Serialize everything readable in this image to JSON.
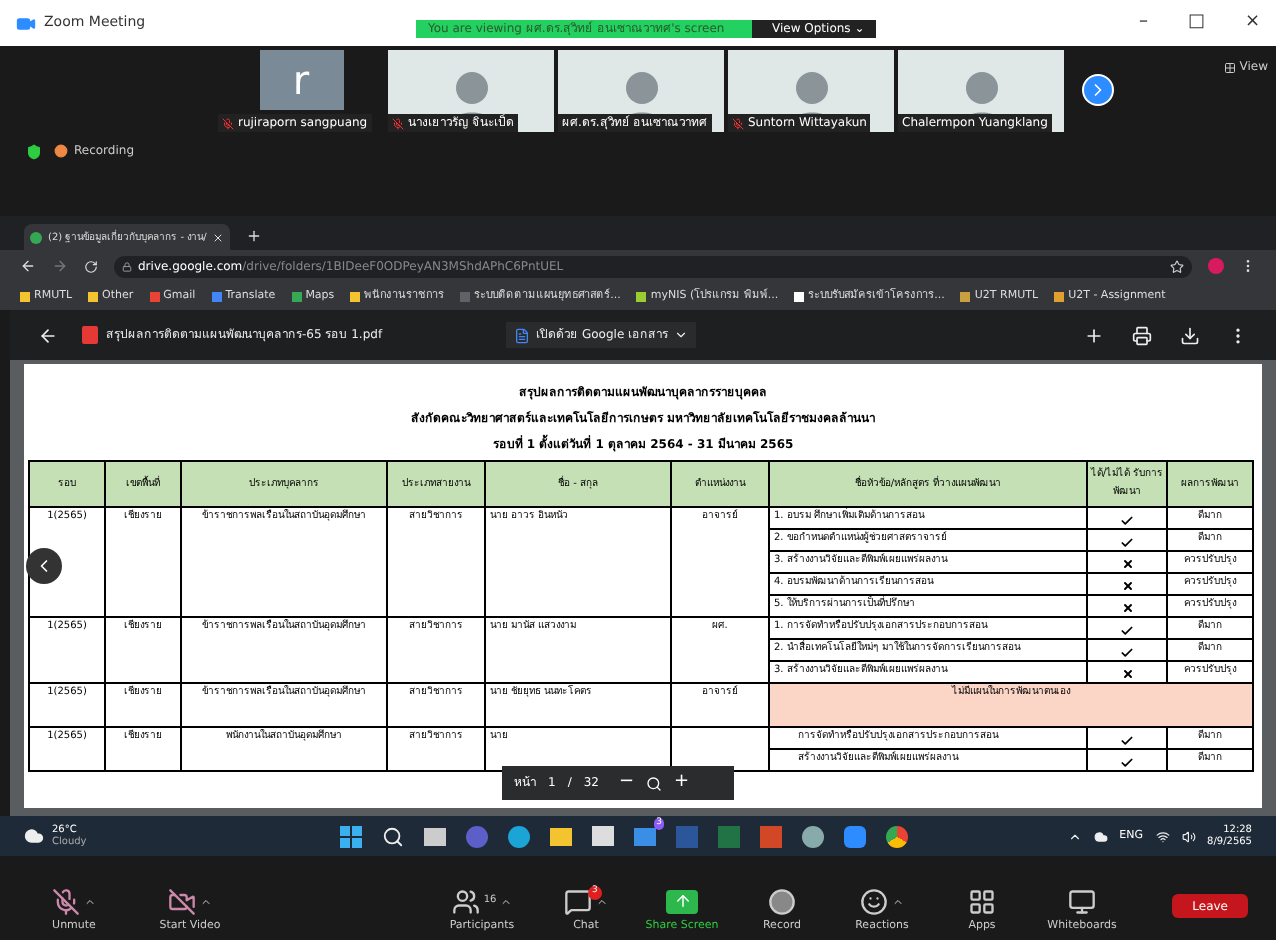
{
  "window": {
    "title": "Zoom Meeting",
    "controls": [
      "–",
      "□",
      "×"
    ]
  },
  "share_banner": {
    "text": "You are viewing ผศ.ดร.สุวิทย์ อนเซาณวาทศ's screen",
    "options": "View Options ⌄"
  },
  "participants": [
    {
      "name": "rujiraporn sangpuang",
      "kind": "avatar",
      "initial": "r",
      "muted": true
    },
    {
      "name": "นางเยาวรัญ จินะเป็ด",
      "kind": "video",
      "muted": true
    },
    {
      "name": "ผศ.ดร.สุวิทย์ อนเซาณวาทศ",
      "kind": "video",
      "muted": false
    },
    {
      "name": "Suntorn Wittayakun",
      "kind": "video",
      "muted": true
    },
    {
      "name": "Chalermpon Yuangklang",
      "kind": "video",
      "muted": false
    }
  ],
  "view_button": "View",
  "recording": "Recording",
  "browser": {
    "tab": "(2) ฐานข้อมูลเกี่ยวกับบุคลากร - งาน/",
    "url_host": "drive.google.com",
    "url_path": "/drive/folders/1BIDeeF0ODPeyAN3MShdAPhC6PntUEL",
    "bookmarks": [
      {
        "label": "RMUTL",
        "color": "#f4c430"
      },
      {
        "label": "Other",
        "color": "#f4c430"
      },
      {
        "label": "Gmail",
        "color": "#ea4335"
      },
      {
        "label": "Translate",
        "color": "#4285f4"
      },
      {
        "label": "Maps",
        "color": "#34a853"
      },
      {
        "label": "พนักงานราชการ",
        "color": "#f4c430"
      },
      {
        "label": "ระบบติดตามแผนยุทธศาสตร์...",
        "color": "#5f6368"
      },
      {
        "label": "myNIS (โปรแกรม พิมพ์...",
        "color": "#9acd32"
      },
      {
        "label": "ระบบรับสมัครเข้าโครงการ...",
        "color": "#ffffff"
      },
      {
        "label": "U2T RMUTL",
        "color": "#c8a040"
      },
      {
        "label": "U2T - Assignment",
        "color": "#e0a030"
      }
    ]
  },
  "pdf": {
    "file": "สรุปผลการติดตามแผนพัฒนาบุคลากร-65 รอบ 1.pdf",
    "open_with": "เปิดด้วย Google เอกสาร",
    "titles": [
      "สรุปผลการติดตามแผนพัฒนาบุคลากรรายบุคคล",
      "สังกัดคณะวิทยาศาสตร์และเทคโนโลยีการเกษตร มหาวิทยาลัยเทคโนโลยีราชมงคลล้านนา",
      "รอบที่ 1 ตั้งแต่วันที่ 1 ตุลาคม 2564 - 31 มีนาคม 2565"
    ],
    "columns": [
      "รอบ",
      "เขตพื้นที่",
      "ประเภทบุคลากร",
      "ประเภทสายงาน",
      "ชื่อ - สกุล",
      "ตำแหน่งงาน",
      "ชื่อหัวข้อ/หลักสูตร ที่วางแผนพัฒนา",
      "ได้/ไม่ได้ รับการพัฒนา",
      "ผลการพัฒนา"
    ],
    "rows": [
      {
        "round": "1(2565)",
        "area": "เชียงราย",
        "staff_type": "ข้าราชการพลเรือนในสถาบันอุดมศึกษา",
        "line": "สายวิชาการ",
        "name": "นาย อาวร อินหนัว",
        "position": "อาจารย์",
        "plans": [
          {
            "topic": "1. อบรม ศึกษาเพิ่มเติมด้านการสอน",
            "done": true,
            "result": "ดีมาก"
          },
          {
            "topic": "2. ขอกำหนดตำแหน่งผู้ช่วยศาสตราจารย์",
            "done": true,
            "result": "ดีมาก"
          },
          {
            "topic": "3. สร้างงานวิจัยและตีพิมพ์เผยแพร่ผลงาน",
            "done": false,
            "result": "ควรปรับปรุง"
          },
          {
            "topic": "4. อบรมพัฒนาด้านการเรียนการสอน",
            "done": false,
            "result": "ควรปรับปรุง"
          },
          {
            "topic": "5. ให้บริการผ่านการเป็นที่ปรึกษา",
            "done": false,
            "result": "ควรปรับปรุง"
          }
        ]
      },
      {
        "round": "1(2565)",
        "area": "เชียงราย",
        "staff_type": "ข้าราชการพลเรือนในสถาบันอุดมศึกษา",
        "line": "สายวิชาการ",
        "name": "นาย มานัส แสวงงาม",
        "position": "ผศ.",
        "plans": [
          {
            "topic": "1. การจัดทำหรือปรับปรุงเอกสารประกอบการสอน",
            "done": true,
            "result": "ดีมาก"
          },
          {
            "topic": "2. นำสื่อเทคโนโลยีใหม่ๆ มาใช้ในการจัดการเรียนการสอน",
            "done": true,
            "result": "ดีมาก"
          },
          {
            "topic": "3. สร้างงานวิจัยและตีพิมพ์เผยแพร่ผลงาน",
            "done": false,
            "result": "ควรปรับปรุง"
          }
        ]
      },
      {
        "round": "1(2565)",
        "area": "เชียงราย",
        "staff_type": "ข้าราชการพลเรือนในสถาบันอุดมศึกษา",
        "line": "สายวิชาการ",
        "name": "นาย ชัยยุทธ นนทะโคตร",
        "position": "อาจารย์",
        "no_plan": "ไม่มีแผนในการพัฒนาตนเอง"
      },
      {
        "round": "1(2565)",
        "area": "เชียงราย",
        "staff_type": "พนักงานในสถาบันอุดมศึกษา",
        "line": "สายวิชาการ",
        "name": "นาย",
        "plans": [
          {
            "topic": "การจัดทำหรือปรับปรุงเอกสารประกอบการสอน",
            "done": true,
            "result": "ดีมาก"
          },
          {
            "topic": "สร้างงานวิจัยและตีพิมพ์เผยแพร่ผลงาน",
            "done": true,
            "result": "ดีมาก"
          }
        ]
      }
    ],
    "page_bar": {
      "label": "หน้า",
      "page": "1",
      "sep": "/",
      "total": "32",
      "minus": "−",
      "plus": "+"
    }
  },
  "taskbar": {
    "temp": "26°C",
    "weather": "Cloudy",
    "lang": "ENG",
    "time": "12:28",
    "date": "8/9/2565",
    "mail_badge": "3"
  },
  "toolbar": [
    {
      "label": "Unmute",
      "kind": "mic",
      "caret": true
    },
    {
      "label": "Start Video",
      "kind": "video",
      "caret": true
    },
    {
      "label": "Participants",
      "kind": "people",
      "caret": true,
      "count": "16"
    },
    {
      "label": "Chat",
      "kind": "chat",
      "caret": true,
      "badge": "3"
    },
    {
      "label": "Share Screen",
      "kind": "share",
      "caret": false
    },
    {
      "label": "Record",
      "kind": "record",
      "caret": false
    },
    {
      "label": "Reactions",
      "kind": "react",
      "caret": true
    },
    {
      "label": "Apps",
      "kind": "apps",
      "caret": false
    },
    {
      "label": "Whiteboards",
      "kind": "board",
      "caret": false
    }
  ],
  "leave": "Leave"
}
